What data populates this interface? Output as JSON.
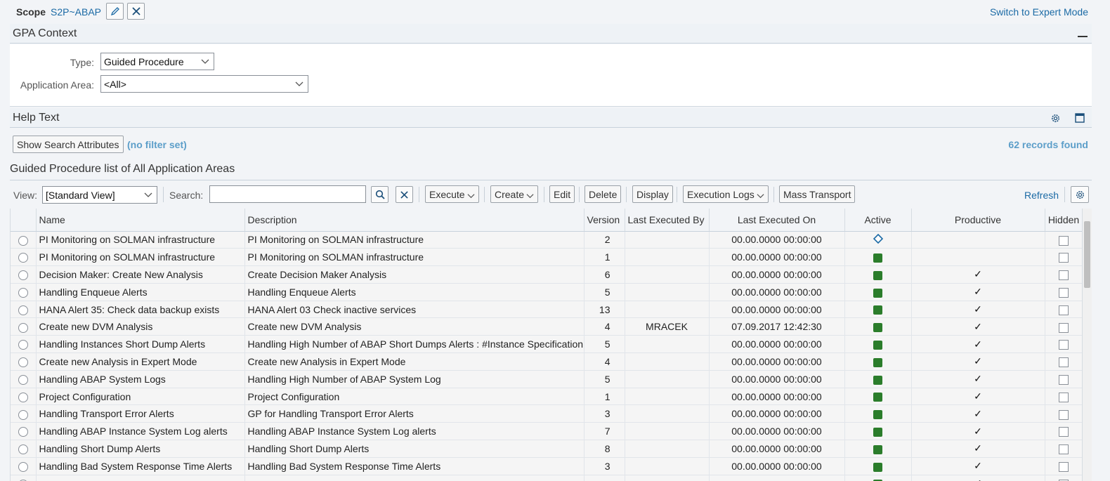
{
  "scope": {
    "label": "Scope",
    "value": "S2P~ABAP",
    "switch_link": "Switch to Expert Mode"
  },
  "gpa_context": {
    "title": "GPA Context",
    "type_label": "Type:",
    "type_value": "Guided Procedure",
    "area_label": "Application Area:",
    "area_value": "<All>"
  },
  "help_text": {
    "title": "Help Text"
  },
  "search": {
    "show_attributes_label": "Show Search Attributes",
    "filter_note": "(no filter set)",
    "records": "62 records found"
  },
  "list_title": "Guided Procedure list of All Application Areas",
  "toolbar": {
    "view_label": "View:",
    "view_value": "[Standard View]",
    "search_label": "Search:",
    "search_value": "",
    "execute": "Execute",
    "create": "Create",
    "edit": "Edit",
    "delete": "Delete",
    "display": "Display",
    "execution_logs": "Execution Logs",
    "mass_transport": "Mass Transport",
    "refresh": "Refresh"
  },
  "table": {
    "columns": [
      "Name",
      "Description",
      "Version",
      "Last Executed By",
      "Last Executed On",
      "Active",
      "Productive",
      "Hidden"
    ],
    "rows": [
      {
        "name": "PI Monitoring on SOLMAN infrastructure",
        "description": "PI Monitoring on SOLMAN infrastructure",
        "version": "2",
        "by": "",
        "on": "00.00.0000 00:00:00",
        "active": "diamond",
        "productive": ""
      },
      {
        "name": "PI Monitoring on SOLMAN infrastructure",
        "description": "PI Monitoring on SOLMAN infrastructure",
        "version": "1",
        "by": "",
        "on": "00.00.0000 00:00:00",
        "active": "green",
        "productive": ""
      },
      {
        "name": "Decision Maker: Create New Analysis",
        "description": "Create Decision Maker Analysis",
        "version": "6",
        "by": "",
        "on": "00.00.0000 00:00:00",
        "active": "green",
        "productive": "✓"
      },
      {
        "name": "Handling Enqueue Alerts",
        "description": "Handling Enqueue Alerts",
        "version": "5",
        "by": "",
        "on": "00.00.0000 00:00:00",
        "active": "green",
        "productive": "✓"
      },
      {
        "name": "HANA Alert 35: Check data backup exists",
        "description": "HANA Alert 03 Check inactive services",
        "version": "13",
        "by": "",
        "on": "00.00.0000 00:00:00",
        "active": "green",
        "productive": "✓"
      },
      {
        "name": "Create new DVM Analysis",
        "description": "Create new DVM Analysis",
        "version": "4",
        "by": "MRACEK",
        "on": "07.09.2017 12:42:30",
        "active": "green",
        "productive": "✓"
      },
      {
        "name": "Handling Instances Short Dump Alerts",
        "description": "Handling High Number of ABAP Short Dumps Alerts : #Instance Specification",
        "version": "5",
        "by": "",
        "on": "00.00.0000 00:00:00",
        "active": "green",
        "productive": "✓"
      },
      {
        "name": "Create new Analysis in Expert Mode",
        "description": "Create new Analysis in Expert Mode",
        "version": "4",
        "by": "",
        "on": "00.00.0000 00:00:00",
        "active": "green",
        "productive": "✓"
      },
      {
        "name": "Handling ABAP System Logs",
        "description": "Handling High Number of ABAP System Log",
        "version": "5",
        "by": "",
        "on": "00.00.0000 00:00:00",
        "active": "green",
        "productive": "✓"
      },
      {
        "name": "Project Configuration",
        "description": "Project Configuration",
        "version": "1",
        "by": "",
        "on": "00.00.0000 00:00:00",
        "active": "green",
        "productive": "✓"
      },
      {
        "name": "Handling Transport Error Alerts",
        "description": "GP for Handling Transport Error Alerts",
        "version": "3",
        "by": "",
        "on": "00.00.0000 00:00:00",
        "active": "green",
        "productive": "✓"
      },
      {
        "name": "Handling ABAP Instance System Log alerts",
        "description": "Handling ABAP Instance System Log alerts",
        "version": "7",
        "by": "",
        "on": "00.00.0000 00:00:00",
        "active": "green",
        "productive": "✓"
      },
      {
        "name": "Handling Short Dump Alerts",
        "description": "Handling Short Dump Alerts",
        "version": "8",
        "by": "",
        "on": "00.00.0000 00:00:00",
        "active": "green",
        "productive": "✓"
      },
      {
        "name": "Handling Bad System Response Time Alerts",
        "description": "Handling Bad System Response Time Alerts",
        "version": "3",
        "by": "",
        "on": "00.00.0000 00:00:00",
        "active": "green",
        "productive": "✓"
      },
      {
        "name": "",
        "description": "",
        "version": "",
        "by": "",
        "on": "",
        "active": "green",
        "productive": "✓"
      }
    ]
  },
  "colors": {
    "link": "#1b6aa5",
    "active_green": "#2b7d2b",
    "info_blue": "#5c9ec9"
  }
}
